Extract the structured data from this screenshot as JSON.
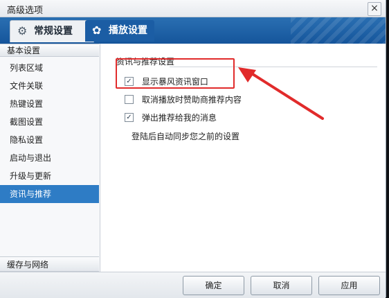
{
  "window": {
    "title": "高级选项",
    "close_label": "×"
  },
  "tabs": [
    {
      "label": "常规设置",
      "icon": "gear-icon",
      "glyph": "⚙",
      "active": true
    },
    {
      "label": "播放设置",
      "icon": "play-settings-icon",
      "glyph": "✿",
      "active": false
    }
  ],
  "sidebar": {
    "header": "基本设置",
    "items": [
      {
        "label": "列表区域"
      },
      {
        "label": "文件关联"
      },
      {
        "label": "热键设置"
      },
      {
        "label": "截图设置"
      },
      {
        "label": "隐私设置"
      },
      {
        "label": "启动与退出"
      },
      {
        "label": "升级与更新"
      },
      {
        "label": "资讯与推荐",
        "selected": true
      }
    ],
    "footer": "缓存与网络"
  },
  "content": {
    "section_title": "资讯与推荐设置",
    "options": [
      {
        "label": "显示暴风资讯窗口",
        "checked": true
      },
      {
        "label": "取消播放时赞助商推荐内容",
        "checked": false
      },
      {
        "label": "弹出推荐给我的消息",
        "checked": true
      }
    ],
    "sync_text": "登陆后自动同步您之前的设置",
    "check_glyph": "✓"
  },
  "buttons": {
    "ok": "确定",
    "cancel": "取消",
    "apply": "应用"
  },
  "colors": {
    "accent": "#2e7cc5",
    "highlight": "#e12b2b",
    "tab_band": "#1b5da4"
  }
}
